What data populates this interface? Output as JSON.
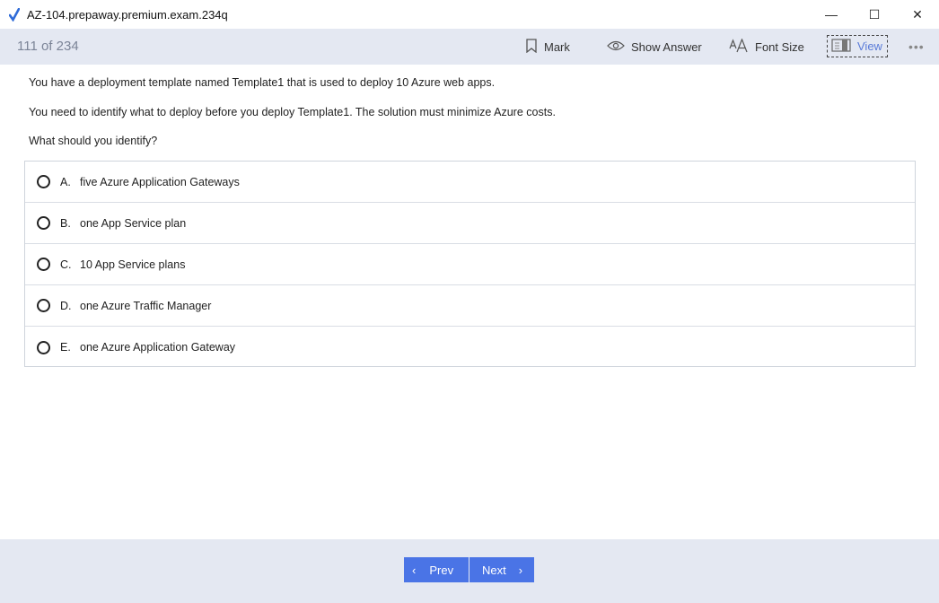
{
  "window": {
    "title": "AZ-104.prepaway.premium.exam.234q",
    "controls": {
      "minimize": "—",
      "maximize": "☐",
      "close": "✕"
    }
  },
  "toolbar": {
    "counter": "111 of 234",
    "mark_label": "Mark",
    "show_answer_label": "Show Answer",
    "font_size_label": "Font Size",
    "view_label": "View",
    "more_label": "•••"
  },
  "question": {
    "lines": [
      "You have a deployment template named Template1 that is used to deploy 10 Azure web apps.",
      "You need to identify what to deploy before you deploy Template1. The solution must minimize Azure costs.",
      "What should you identify?"
    ],
    "options": [
      {
        "letter": "A.",
        "text": "five Azure Application Gateways"
      },
      {
        "letter": "B.",
        "text": "one App Service plan"
      },
      {
        "letter": "C.",
        "text": "10 App Service plans"
      },
      {
        "letter": "D.",
        "text": "one Azure Traffic Manager"
      },
      {
        "letter": "E.",
        "text": "one Azure Application Gateway"
      }
    ]
  },
  "footer": {
    "prev_label": "Prev",
    "next_label": "Next",
    "prev_chevron": "‹",
    "next_chevron": "›"
  },
  "colors": {
    "accent": "#4a74e6",
    "toolbar_bg": "#e4e8f2",
    "view_text": "#5a7bd8"
  }
}
